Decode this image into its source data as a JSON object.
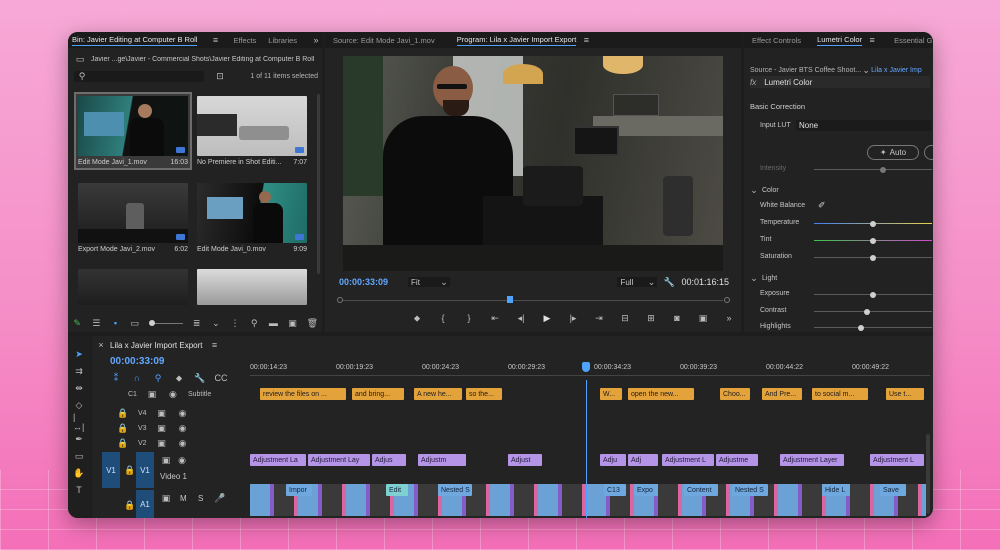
{
  "project_panel": {
    "tabs": [
      "Bin: Javier Editing at Computer B Roll",
      "Effects",
      "Libraries"
    ],
    "path": "Javier ...ge\\Javier - Commercial Shots\\Javier Editing at Computer B Roll",
    "items_selected": "1 of 11 items selected",
    "clips": [
      {
        "name": "Edit Mode Javi_1.mov",
        "duration": "16:03"
      },
      {
        "name": "No Premiere in Shot Editi...",
        "duration": "7:07"
      },
      {
        "name": "Export Mode Javi_2.mov",
        "duration": "6:02"
      },
      {
        "name": "Edit Mode Javi_0.mov",
        "duration": "9:09"
      }
    ]
  },
  "source_tab": "Source: Edit Mode Javi_1.mov",
  "program_monitor": {
    "tab": "Program: Lila x Javier Import Export",
    "timecode": "00:00:33:09",
    "fit": "Fit",
    "quality": "Full",
    "duration": "00:01:16:15"
  },
  "lumetri": {
    "tabs": [
      "Effect Controls",
      "Lumetri Color",
      "Essential G"
    ],
    "source": "Source - Javier BTS Coffee Shoot...",
    "sequence": "Lila x Javier Imp",
    "effect": "Lumetri Color",
    "section": "Basic Correction",
    "input_lut_label": "Input LUT",
    "input_lut_value": "None",
    "auto": "Auto",
    "intensity": "Intensity",
    "color": "Color",
    "white_balance": "White Balance",
    "temperature": "Temperature",
    "tint": "Tint",
    "saturation": "Saturation",
    "light": "Light",
    "exposure": "Exposure",
    "contrast": "Contrast",
    "highlights": "Highlights",
    "temperature_level": 0.5,
    "tint_level": 0.5,
    "saturation_level": 0.5,
    "exposure_level": 0.5,
    "contrast_level": 0.45,
    "highlights_level": 0.4
  },
  "timeline": {
    "tab": "Lila x Javier Import Export",
    "timecode": "00:00:33:09",
    "ruler": [
      "00:00:14:23",
      "00:00:19:23",
      "00:00:24:23",
      "00:00:29:23",
      "00:00:34:23",
      "00:00:39:23",
      "00:00:44:22",
      "00:00:49:22"
    ],
    "subtitle_track": "Subtitle",
    "subtitle_clips": [
      "review the files on ...",
      "and bring...",
      "A new he...",
      "so the...",
      "W...",
      "open the new...",
      "Choo...",
      "And Pre...",
      "to social m...",
      "Use t..."
    ],
    "tracks": {
      "v4": "V4",
      "v3": "V3",
      "v2": "V2",
      "v1": "V1",
      "v1_name": "Video 1",
      "a1": "A1",
      "c1": "C1",
      "m": "M",
      "s": "S"
    },
    "adjustment_clips": [
      "Adjustment La",
      "Adjustment Lay",
      "Adjus",
      "Adjustm",
      "Adjust",
      "Adju",
      "Adj",
      "Adjustment L",
      "Adjustme",
      "Adjustment Layer",
      "Adjustment L"
    ],
    "video_clips": [
      "Impor",
      "Edit",
      "Nested S",
      "C13",
      "Expo",
      "Content",
      "Nested S",
      "Hide L",
      "Save"
    ]
  },
  "colors": {
    "accent": "#4da3ff",
    "timecode": "#62a8ff",
    "subtitle": "#e4a23a",
    "adjustment": "#b494e6",
    "audio": "#2f8f6d"
  }
}
